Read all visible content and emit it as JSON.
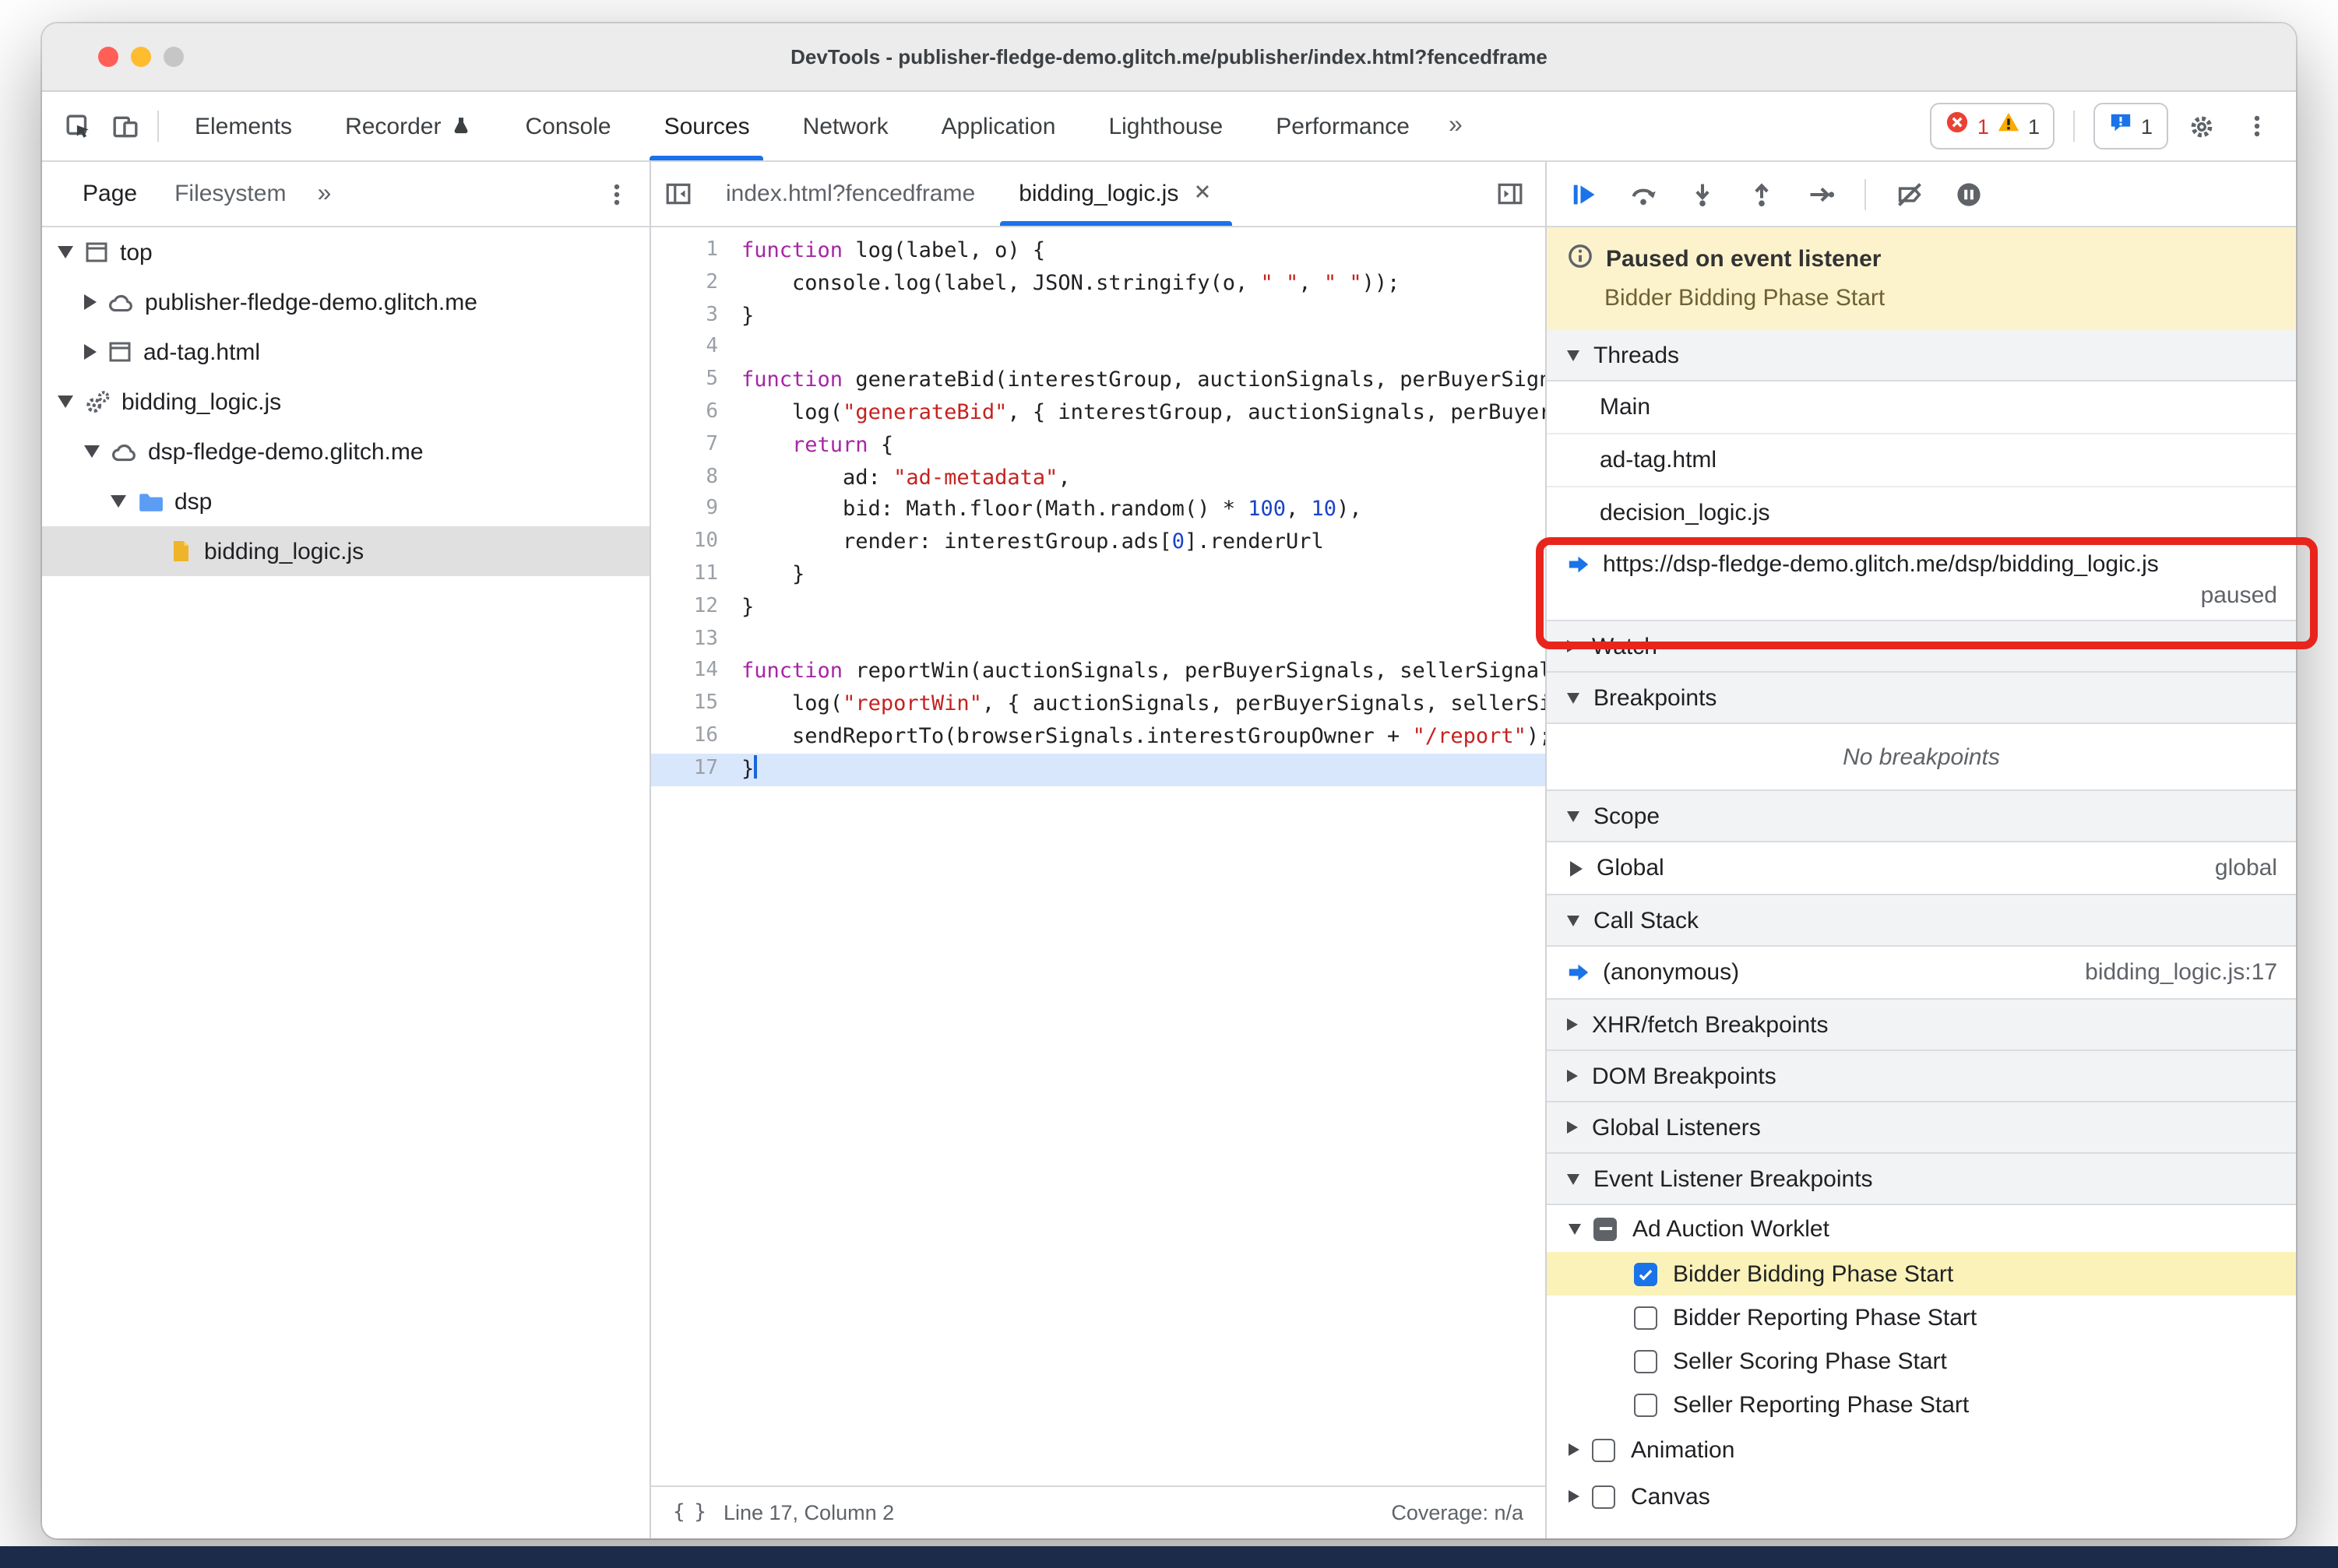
{
  "colors": {
    "accent": "#1a73e8",
    "annotation_red": "#e8251d",
    "paused_banner": "#fcf3cd",
    "highlight_yellow": "#faf2b8",
    "exec_line_blue": "#d9e7fd",
    "bottom_strip": "#1c2b4a"
  },
  "window": {
    "title": "DevTools - publisher-fledge-demo.glitch.me/publisher/index.html?fencedframe"
  },
  "toolbar": {
    "tabs": [
      {
        "label": "Elements"
      },
      {
        "label": "Recorder",
        "icon": "flask"
      },
      {
        "label": "Console"
      },
      {
        "label": "Sources",
        "active": true
      },
      {
        "label": "Network"
      },
      {
        "label": "Application"
      },
      {
        "label": "Lighthouse"
      },
      {
        "label": "Performance"
      }
    ],
    "more_label": "»",
    "error_count": "1",
    "warning_count": "1",
    "issues_count": "1"
  },
  "navigator": {
    "tabs": [
      {
        "label": "Page",
        "active": true
      },
      {
        "label": "Filesystem"
      }
    ],
    "more_label": "»",
    "tree": [
      {
        "label": "top",
        "icon": "frame",
        "disclosure": "open",
        "depth": 0
      },
      {
        "label": "publisher-fledge-demo.glitch.me",
        "icon": "cloud",
        "disclosure": "closed",
        "depth": 1
      },
      {
        "label": "ad-tag.html",
        "icon": "frame",
        "disclosure": "closed",
        "depth": 1
      },
      {
        "label": "bidding_logic.js",
        "icon": "worklet",
        "disclosure": "open",
        "depth": 0
      },
      {
        "label": "dsp-fledge-demo.glitch.me",
        "icon": "cloud",
        "disclosure": "open",
        "depth": 1
      },
      {
        "label": "dsp",
        "icon": "folder",
        "disclosure": "open",
        "depth": 2
      },
      {
        "label": "bidding_logic.js",
        "icon": "jsfile",
        "disclosure": "none",
        "depth": 3,
        "selected": true
      }
    ]
  },
  "editor": {
    "tabs": [
      {
        "label": "index.html?fencedframe"
      },
      {
        "label": "bidding_logic.js",
        "active": true,
        "closable": true
      }
    ],
    "exec_line": 17,
    "status": {
      "braces": "{ }",
      "line_info": "Line 17, Column 2",
      "coverage": "Coverage: n/a"
    },
    "code_lines": [
      [
        [
          "k",
          "function"
        ],
        [
          "p",
          " log(label, o) {"
        ]
      ],
      [
        [
          "p",
          "    console.log(label, JSON.stringify(o, "
        ],
        [
          "s",
          "\" \""
        ],
        [
          "p",
          ", "
        ],
        [
          "s",
          "\" \""
        ],
        [
          "p",
          "));"
        ]
      ],
      [
        [
          "p",
          "}"
        ]
      ],
      [],
      [
        [
          "k",
          "function"
        ],
        [
          "p",
          " generateBid(interestGroup, auctionSignals, perBuyerSignals, trustedBiddingSignals, browserSignals) {"
        ]
      ],
      [
        [
          "p",
          "    log("
        ],
        [
          "s",
          "\"generateBid\""
        ],
        [
          "p",
          ", { interestGroup, auctionSignals, perBuyerSignals, trustedBiddingSignals, browserSignals });"
        ]
      ],
      [
        [
          "p",
          "    "
        ],
        [
          "k",
          "return"
        ],
        [
          "p",
          " {"
        ]
      ],
      [
        [
          "p",
          "        ad: "
        ],
        [
          "s",
          "\"ad-metadata\""
        ],
        [
          "p",
          ","
        ]
      ],
      [
        [
          "p",
          "        bid: Math.floor(Math.random() * "
        ],
        [
          "n",
          "100"
        ],
        [
          "p",
          ", "
        ],
        [
          "n",
          "10"
        ],
        [
          "p",
          "),"
        ]
      ],
      [
        [
          "p",
          "        render: interestGroup.ads["
        ],
        [
          "n",
          "0"
        ],
        [
          "p",
          "].renderUrl"
        ]
      ],
      [
        [
          "p",
          "    }"
        ]
      ],
      [
        [
          "p",
          "}"
        ]
      ],
      [],
      [
        [
          "k",
          "function"
        ],
        [
          "p",
          " reportWin(auctionSignals, perBuyerSignals, sellerSignals, browserSignals) {"
        ]
      ],
      [
        [
          "p",
          "    log("
        ],
        [
          "s",
          "\"reportWin\""
        ],
        [
          "p",
          ", { auctionSignals, perBuyerSignals, sellerSignals, browserSignals });"
        ]
      ],
      [
        [
          "p",
          "    sendReportTo(browserSignals.interestGroupOwner + "
        ],
        [
          "s",
          "\"/report\""
        ],
        [
          "p",
          ");"
        ]
      ],
      [
        [
          "p",
          "}"
        ]
      ]
    ]
  },
  "debugger": {
    "toolbar_buttons": [
      "resume",
      "step-over",
      "step-into",
      "step-out",
      "step",
      "deactivate-breakpoints",
      "pause-on-exceptions"
    ],
    "paused_title": "Paused on event listener",
    "paused_subtitle": "Bidder Bidding Phase Start",
    "sections": [
      {
        "title": "Threads",
        "state": "open",
        "type": "threads",
        "rows": [
          {
            "label": "Main"
          },
          {
            "label": "ad-tag.html"
          },
          {
            "label": "decision_logic.js"
          },
          {
            "label": "https://dsp-fledge-demo.glitch.me/dsp/bidding_logic.js",
            "active": true,
            "badge": "paused"
          }
        ]
      },
      {
        "title": "Watch",
        "state": "closed"
      },
      {
        "title": "Breakpoints",
        "state": "open",
        "type": "empty",
        "empty_text": "No breakpoints"
      },
      {
        "title": "Scope",
        "state": "open",
        "type": "kv",
        "rows": [
          {
            "label": "Global",
            "value": "global"
          }
        ]
      },
      {
        "title": "Call Stack",
        "state": "open",
        "type": "stack",
        "rows": [
          {
            "label": "(anonymous)",
            "value": "bidding_logic.js:17",
            "active": true
          }
        ]
      },
      {
        "title": "XHR/fetch Breakpoints",
        "state": "closed"
      },
      {
        "title": "DOM Breakpoints",
        "state": "closed"
      },
      {
        "title": "Global Listeners",
        "state": "closed"
      },
      {
        "title": "Event Listener Breakpoints",
        "state": "open",
        "type": "listeners",
        "rows": [
          {
            "label": "Ad Auction Worklet",
            "disclosure": "open",
            "checkbox": "indeterminate",
            "depth": 0
          },
          {
            "label": "Bidder Bidding Phase Start",
            "checkbox": "checked",
            "depth": 1,
            "highlight": true
          },
          {
            "label": "Bidder Reporting Phase Start",
            "checkbox": "unchecked",
            "depth": 1
          },
          {
            "label": "Seller Scoring Phase Start",
            "checkbox": "unchecked",
            "depth": 1
          },
          {
            "label": "Seller Reporting Phase Start",
            "checkbox": "unchecked",
            "depth": 1
          },
          {
            "label": "Animation",
            "disclosure": "closed",
            "checkbox": "unchecked",
            "depth": 0
          },
          {
            "label": "Canvas",
            "disclosure": "closed",
            "checkbox": "unchecked",
            "depth": 0
          }
        ]
      }
    ]
  }
}
